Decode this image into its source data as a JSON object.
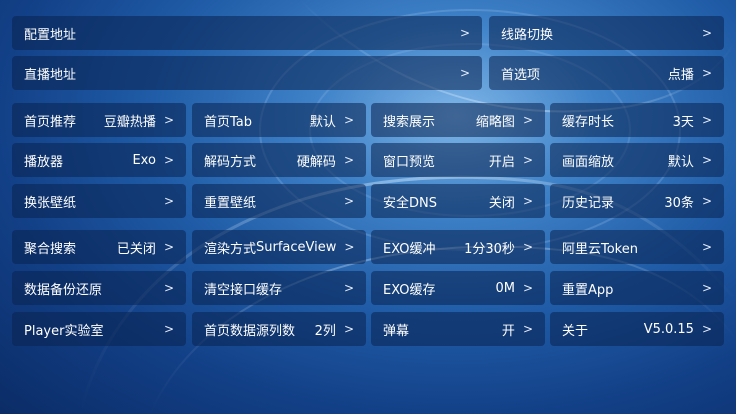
{
  "top": {
    "config_address": {
      "label": "配置地址"
    },
    "line_switch": {
      "label": "线路切换"
    },
    "live_address": {
      "label": "直播地址"
    },
    "preferences": {
      "label": "首选项",
      "value": "点播"
    }
  },
  "grid": [
    [
      {
        "label": "首页推荐",
        "value": "豆瓣热播"
      },
      {
        "label": "首页Tab",
        "value": "默认"
      },
      {
        "label": "搜索展示",
        "value": "缩略图"
      },
      {
        "label": "缓存时长",
        "value": "3天"
      }
    ],
    [
      {
        "label": "播放器",
        "value": "Exo"
      },
      {
        "label": "解码方式",
        "value": "硬解码"
      },
      {
        "label": "窗口预览",
        "value": "开启"
      },
      {
        "label": "画面缩放",
        "value": "默认"
      }
    ],
    [
      {
        "label": "换张壁纸",
        "value": ""
      },
      {
        "label": "重置壁纸",
        "value": ""
      },
      {
        "label": "安全DNS",
        "value": "关闭"
      },
      {
        "label": "历史记录",
        "value": "30条"
      }
    ],
    [
      {
        "label": "聚合搜索",
        "value": "已关闭"
      },
      {
        "label": "渲染方式",
        "value": "SurfaceView"
      },
      {
        "label": "EXO缓冲",
        "value": "1分30秒"
      },
      {
        "label": "阿里云Token",
        "value": ""
      }
    ],
    [
      {
        "label": "数据备份还原",
        "value": ""
      },
      {
        "label": "清空接口缓存",
        "value": ""
      },
      {
        "label": "EXO缓存",
        "value": "0M"
      },
      {
        "label": "重置App",
        "value": ""
      }
    ],
    [
      {
        "label": "Player实验室",
        "value": ""
      },
      {
        "label": "首页数据源列数",
        "value": "2列"
      },
      {
        "label": "弹幕",
        "value": "开"
      },
      {
        "label": "关于",
        "value": "V5.0.15"
      }
    ]
  ],
  "arrow": ">",
  "colors": {
    "background": "#1f5ba6",
    "cell": "#0a2350"
  }
}
